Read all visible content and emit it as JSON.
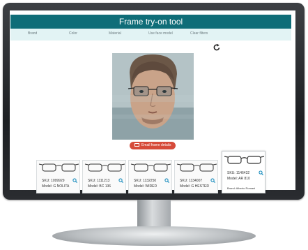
{
  "app": {
    "title": "Frame try-on tool"
  },
  "filters": [
    "Brand",
    "Color",
    "Material",
    "Use face model",
    "Clear filters"
  ],
  "actions": {
    "email_label": "Email frame details"
  },
  "products": [
    {
      "sku": "SKU: 1099929",
      "model": "Model: G NOLITA"
    },
    {
      "sku": "SKU: 1111213",
      "model": "Model: BC 136"
    },
    {
      "sku": "SKU: 1132250",
      "model": "Model: WIRED"
    },
    {
      "sku": "SKU: 1134007",
      "model": "Model: G HESTER"
    },
    {
      "sku": "SKU: 1146432",
      "model": "Model: AR 810",
      "brand": "Brand: Alberto Romani"
    }
  ],
  "colors": {
    "header": "#0f6d78",
    "filter_bar": "#e2f3f4",
    "accent": "#d64b3a",
    "search_icon": "#1e8fbf"
  }
}
